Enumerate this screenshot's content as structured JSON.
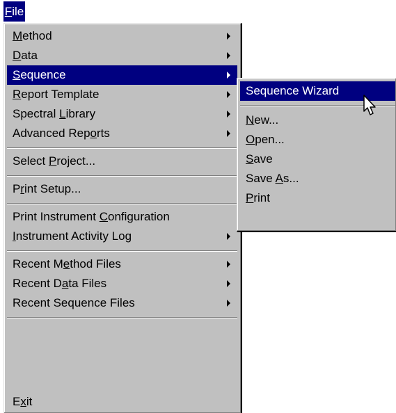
{
  "menubar": {
    "file_label": "File",
    "file_mnemonic": "F",
    "file_rest": "ile"
  },
  "file_menu": {
    "items": [
      {
        "pre": "",
        "key": "M",
        "post": "ethod"
      },
      {
        "pre": "",
        "key": "D",
        "post": "ata"
      },
      {
        "pre": "",
        "key": "S",
        "post": "equence"
      },
      {
        "pre": "",
        "key": "R",
        "post": "eport Template"
      },
      {
        "pre": "Spectral ",
        "key": "L",
        "post": "ibrary"
      },
      {
        "pre": "Advanced Rep",
        "key": "o",
        "post": "rts"
      },
      {
        "pre": "Select ",
        "key": "P",
        "post": "roject..."
      },
      {
        "pre": "P",
        "key": "r",
        "post": "int Setup..."
      },
      {
        "pre": "Print Instrument ",
        "key": "C",
        "post": "onfiguration"
      },
      {
        "pre": "",
        "key": "I",
        "post": "nstrument Activity Log"
      },
      {
        "pre": "Recent M",
        "key": "e",
        "post": "thod Files"
      },
      {
        "pre": "Recent D",
        "key": "a",
        "post": "ta Files"
      },
      {
        "pre": "Recent Se",
        "key": "",
        "post": "quence Files"
      },
      {
        "pre": "E",
        "key": "x",
        "post": "it"
      }
    ]
  },
  "sequence_submenu": {
    "items": [
      {
        "pre": "Sequence Wizard",
        "key": "",
        "post": ""
      },
      {
        "pre": "",
        "key": "N",
        "post": "ew..."
      },
      {
        "pre": "",
        "key": "O",
        "post": "pen..."
      },
      {
        "pre": "",
        "key": "S",
        "post": "ave"
      },
      {
        "pre": "Save ",
        "key": "A",
        "post": "s..."
      },
      {
        "pre": "",
        "key": "P",
        "post": "rint"
      }
    ]
  },
  "highlight_color": "#000080",
  "menu_face_color": "#c0c0c0"
}
